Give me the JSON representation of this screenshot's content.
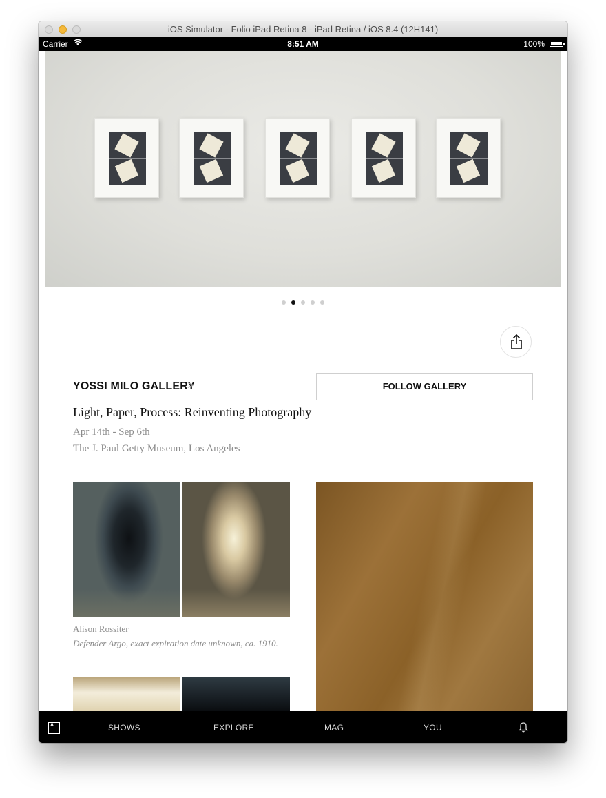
{
  "window": {
    "title": "iOS Simulator - Folio iPad Retina 8 - iPad Retina / iOS 8.4 (12H141)"
  },
  "status_bar": {
    "carrier": "Carrier",
    "time": "8:51 AM",
    "battery": "100%"
  },
  "hero": {
    "page_count": 5,
    "active_page": 2
  },
  "gallery": {
    "name": "YOSSI MILO GALLERY",
    "chevron": ">",
    "follow_label": "FOLLOW GALLERY"
  },
  "show": {
    "title": "Light, Paper, Process: Reinventing Photography",
    "dates": "Apr 14th - Sep 6th",
    "location": "The J. Paul Getty Museum, Los Angeles"
  },
  "artwork": {
    "artist": "Alison Rossiter",
    "title": "Defender Argo, exact expiration date unknown, ca. 1910."
  },
  "tabbar": {
    "logo": "A",
    "shows": "SHOWS",
    "explore": "EXPLORE",
    "mag": "MAG",
    "you": "YOU"
  },
  "icons": {
    "share": "share-icon",
    "bell": "bell-icon",
    "wifi": "wifi-icon"
  }
}
